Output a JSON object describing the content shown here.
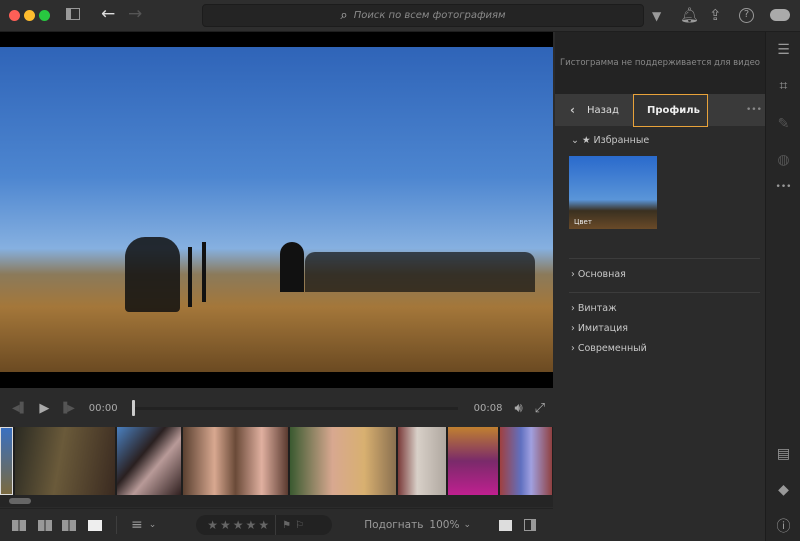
{
  "titlebar": {
    "search_placeholder": "Поиск по всем фотографиям"
  },
  "histogram": {
    "message": "Гистограмма не поддерживается для видео"
  },
  "panel": {
    "back_label": "Назад",
    "title": "Профиль",
    "more": "•••",
    "favorites": "Избранные",
    "favorite_thumb_label": "Цвет",
    "groups": [
      "Основная",
      "Винтаж",
      "Имитация",
      "Современный"
    ]
  },
  "player": {
    "current_time": "00:00",
    "duration": "00:08",
    "progress": 0
  },
  "bottombar": {
    "fit_label": "Подогнать",
    "zoom": "100%"
  },
  "colors": {
    "accent": "#e8a23a"
  }
}
